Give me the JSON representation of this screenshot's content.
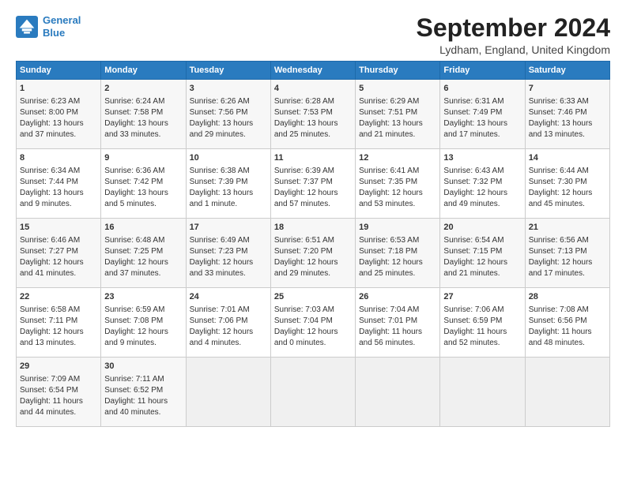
{
  "header": {
    "logo_line1": "General",
    "logo_line2": "Blue",
    "title": "September 2024",
    "location": "Lydham, England, United Kingdom"
  },
  "weekdays": [
    "Sunday",
    "Monday",
    "Tuesday",
    "Wednesday",
    "Thursday",
    "Friday",
    "Saturday"
  ],
  "weeks": [
    [
      {
        "day": "1",
        "lines": [
          "Sunrise: 6:23 AM",
          "Sunset: 8:00 PM",
          "Daylight: 13 hours",
          "and 37 minutes."
        ]
      },
      {
        "day": "2",
        "lines": [
          "Sunrise: 6:24 AM",
          "Sunset: 7:58 PM",
          "Daylight: 13 hours",
          "and 33 minutes."
        ]
      },
      {
        "day": "3",
        "lines": [
          "Sunrise: 6:26 AM",
          "Sunset: 7:56 PM",
          "Daylight: 13 hours",
          "and 29 minutes."
        ]
      },
      {
        "day": "4",
        "lines": [
          "Sunrise: 6:28 AM",
          "Sunset: 7:53 PM",
          "Daylight: 13 hours",
          "and 25 minutes."
        ]
      },
      {
        "day": "5",
        "lines": [
          "Sunrise: 6:29 AM",
          "Sunset: 7:51 PM",
          "Daylight: 13 hours",
          "and 21 minutes."
        ]
      },
      {
        "day": "6",
        "lines": [
          "Sunrise: 6:31 AM",
          "Sunset: 7:49 PM",
          "Daylight: 13 hours",
          "and 17 minutes."
        ]
      },
      {
        "day": "7",
        "lines": [
          "Sunrise: 6:33 AM",
          "Sunset: 7:46 PM",
          "Daylight: 13 hours",
          "and 13 minutes."
        ]
      }
    ],
    [
      {
        "day": "8",
        "lines": [
          "Sunrise: 6:34 AM",
          "Sunset: 7:44 PM",
          "Daylight: 13 hours",
          "and 9 minutes."
        ]
      },
      {
        "day": "9",
        "lines": [
          "Sunrise: 6:36 AM",
          "Sunset: 7:42 PM",
          "Daylight: 13 hours",
          "and 5 minutes."
        ]
      },
      {
        "day": "10",
        "lines": [
          "Sunrise: 6:38 AM",
          "Sunset: 7:39 PM",
          "Daylight: 13 hours",
          "and 1 minute."
        ]
      },
      {
        "day": "11",
        "lines": [
          "Sunrise: 6:39 AM",
          "Sunset: 7:37 PM",
          "Daylight: 12 hours",
          "and 57 minutes."
        ]
      },
      {
        "day": "12",
        "lines": [
          "Sunrise: 6:41 AM",
          "Sunset: 7:35 PM",
          "Daylight: 12 hours",
          "and 53 minutes."
        ]
      },
      {
        "day": "13",
        "lines": [
          "Sunrise: 6:43 AM",
          "Sunset: 7:32 PM",
          "Daylight: 12 hours",
          "and 49 minutes."
        ]
      },
      {
        "day": "14",
        "lines": [
          "Sunrise: 6:44 AM",
          "Sunset: 7:30 PM",
          "Daylight: 12 hours",
          "and 45 minutes."
        ]
      }
    ],
    [
      {
        "day": "15",
        "lines": [
          "Sunrise: 6:46 AM",
          "Sunset: 7:27 PM",
          "Daylight: 12 hours",
          "and 41 minutes."
        ]
      },
      {
        "day": "16",
        "lines": [
          "Sunrise: 6:48 AM",
          "Sunset: 7:25 PM",
          "Daylight: 12 hours",
          "and 37 minutes."
        ]
      },
      {
        "day": "17",
        "lines": [
          "Sunrise: 6:49 AM",
          "Sunset: 7:23 PM",
          "Daylight: 12 hours",
          "and 33 minutes."
        ]
      },
      {
        "day": "18",
        "lines": [
          "Sunrise: 6:51 AM",
          "Sunset: 7:20 PM",
          "Daylight: 12 hours",
          "and 29 minutes."
        ]
      },
      {
        "day": "19",
        "lines": [
          "Sunrise: 6:53 AM",
          "Sunset: 7:18 PM",
          "Daylight: 12 hours",
          "and 25 minutes."
        ]
      },
      {
        "day": "20",
        "lines": [
          "Sunrise: 6:54 AM",
          "Sunset: 7:15 PM",
          "Daylight: 12 hours",
          "and 21 minutes."
        ]
      },
      {
        "day": "21",
        "lines": [
          "Sunrise: 6:56 AM",
          "Sunset: 7:13 PM",
          "Daylight: 12 hours",
          "and 17 minutes."
        ]
      }
    ],
    [
      {
        "day": "22",
        "lines": [
          "Sunrise: 6:58 AM",
          "Sunset: 7:11 PM",
          "Daylight: 12 hours",
          "and 13 minutes."
        ]
      },
      {
        "day": "23",
        "lines": [
          "Sunrise: 6:59 AM",
          "Sunset: 7:08 PM",
          "Daylight: 12 hours",
          "and 9 minutes."
        ]
      },
      {
        "day": "24",
        "lines": [
          "Sunrise: 7:01 AM",
          "Sunset: 7:06 PM",
          "Daylight: 12 hours",
          "and 4 minutes."
        ]
      },
      {
        "day": "25",
        "lines": [
          "Sunrise: 7:03 AM",
          "Sunset: 7:04 PM",
          "Daylight: 12 hours",
          "and 0 minutes."
        ]
      },
      {
        "day": "26",
        "lines": [
          "Sunrise: 7:04 AM",
          "Sunset: 7:01 PM",
          "Daylight: 11 hours",
          "and 56 minutes."
        ]
      },
      {
        "day": "27",
        "lines": [
          "Sunrise: 7:06 AM",
          "Sunset: 6:59 PM",
          "Daylight: 11 hours",
          "and 52 minutes."
        ]
      },
      {
        "day": "28",
        "lines": [
          "Sunrise: 7:08 AM",
          "Sunset: 6:56 PM",
          "Daylight: 11 hours",
          "and 48 minutes."
        ]
      }
    ],
    [
      {
        "day": "29",
        "lines": [
          "Sunrise: 7:09 AM",
          "Sunset: 6:54 PM",
          "Daylight: 11 hours",
          "and 44 minutes."
        ]
      },
      {
        "day": "30",
        "lines": [
          "Sunrise: 7:11 AM",
          "Sunset: 6:52 PM",
          "Daylight: 11 hours",
          "and 40 minutes."
        ]
      },
      {
        "day": "",
        "lines": []
      },
      {
        "day": "",
        "lines": []
      },
      {
        "day": "",
        "lines": []
      },
      {
        "day": "",
        "lines": []
      },
      {
        "day": "",
        "lines": []
      }
    ]
  ]
}
